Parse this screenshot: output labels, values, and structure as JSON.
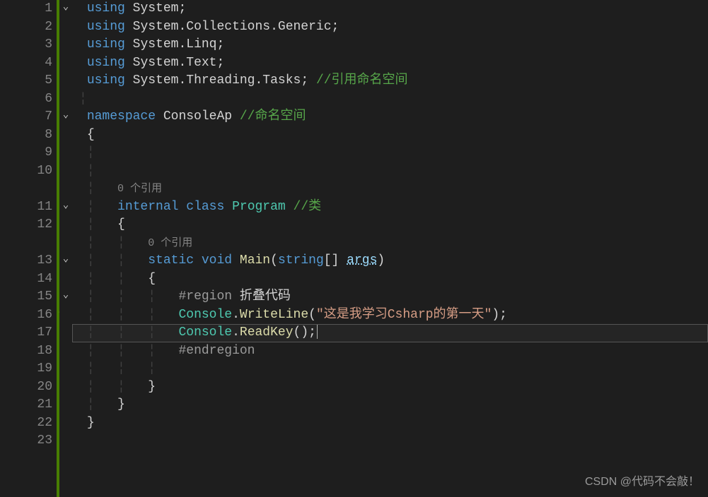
{
  "lines": {
    "1": {
      "n": "1"
    },
    "2": {
      "n": "2"
    },
    "3": {
      "n": "3"
    },
    "4": {
      "n": "4"
    },
    "5": {
      "n": "5"
    },
    "6": {
      "n": "6"
    },
    "7": {
      "n": "7"
    },
    "8": {
      "n": "8"
    },
    "9": {
      "n": "9"
    },
    "10": {
      "n": "10"
    },
    "ref1": {
      "n": ""
    },
    "11": {
      "n": "11"
    },
    "12": {
      "n": "12"
    },
    "ref2": {
      "n": ""
    },
    "13": {
      "n": "13"
    },
    "14": {
      "n": "14"
    },
    "15": {
      "n": "15"
    },
    "16": {
      "n": "16"
    },
    "17": {
      "n": "17"
    },
    "18": {
      "n": "18"
    },
    "19": {
      "n": "19"
    },
    "20": {
      "n": "20"
    },
    "21": {
      "n": "21"
    },
    "22": {
      "n": "22"
    },
    "23": {
      "n": "23"
    }
  },
  "tok": {
    "using": "using",
    "System": "System",
    "Collections": "Collections",
    "Generic": "Generic",
    "Linq": "Linq",
    "Text": "Text",
    "Threading": "Threading",
    "Tasks": "Tasks",
    "semicolon": ";",
    "dot": ".",
    "cmt1": "//引用命名空间",
    "namespace": "namespace",
    "ConsoleAp": "ConsoleAp",
    "cmt2": "//命名空间",
    "lbrace": "{",
    "rbrace": "}",
    "ref0": "0 个引用",
    "internal": "internal",
    "class": "class",
    "Program": "Program",
    "cmt3": "//类",
    "static": "static",
    "void": "void",
    "Main": "Main",
    "lparen": "(",
    "string": "string",
    "brackets": "[]",
    "args": "args",
    "rparen": ")",
    "region": "#region",
    "regionName": "折叠代码",
    "Console": "Console",
    "WriteLine": "WriteLine",
    "strlit": "\"这是我学习Csharp的第一天\"",
    "ReadKey": "ReadKey",
    "endregion": "#endregion"
  },
  "watermark": "CSDN @代码不会敲！"
}
